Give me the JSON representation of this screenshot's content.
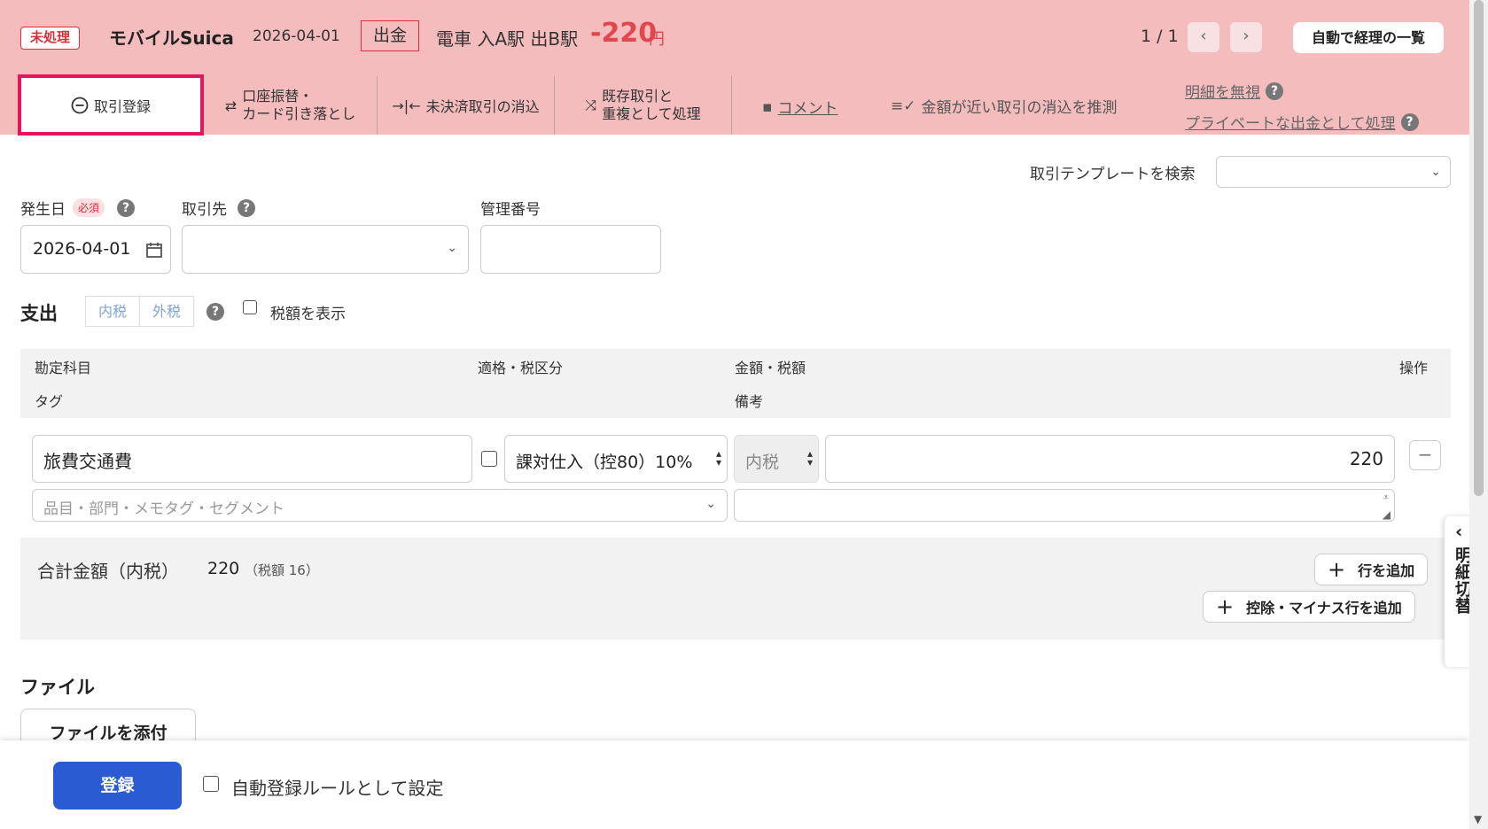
{
  "header": {
    "status": "未処理",
    "account": "モバイルSuica",
    "date": "2026-04-01",
    "type": "出金",
    "description": "電車 入A駅 出B駅",
    "amount": "-220",
    "unit": "円",
    "pager": "1 / 1",
    "prev": "‹",
    "next": "›",
    "auto_list": "自動で経理の一覧"
  },
  "tabs": {
    "register": "取引登録",
    "transfer_line1": "口座振替・",
    "transfer_line2": "カード引き落とし",
    "reconcile": "未決済取引の消込",
    "duplicate_line1": "既存取引と",
    "duplicate_line2": "重複として処理",
    "comment": "コメント",
    "guess": "金額が近い取引の消込を推測",
    "ignore": "明細を無視",
    "private": "プライベートな出金として処理"
  },
  "form": {
    "template_label": "取引テンプレートを検索",
    "date_label": "発生日",
    "required": "必須",
    "date_value": "2026-04-01",
    "partner_label": "取引先",
    "mgmt_label": "管理番号",
    "section_title": "支出",
    "tax_in": "内税",
    "tax_out": "外税",
    "show_tax": "税額を表示"
  },
  "table": {
    "col_account": "勘定科目",
    "col_tax": "適格・税区分",
    "col_amount": "金額・税額",
    "col_ops": "操作",
    "col_tag": "タグ",
    "col_note": "備考",
    "row": {
      "account": "旅費交通費",
      "tax_category": "課対仕入（控80）10%",
      "tax_mode": "内税",
      "amount": "220",
      "tag_placeholder": "品目・部門・メモタグ・セグメント",
      "remove": "−"
    }
  },
  "totals": {
    "label": "合計金額（内税）",
    "amount": "220",
    "tax": "（税額 16）",
    "add_row": "行を追加",
    "add_minus_row": "控除・マイナス行を追加"
  },
  "file": {
    "title": "ファイル",
    "attach": "ファイルを添付"
  },
  "footer": {
    "submit": "登録",
    "auto_rule": "自動登録ルールとして設定"
  },
  "side": {
    "label": "明細切替"
  }
}
